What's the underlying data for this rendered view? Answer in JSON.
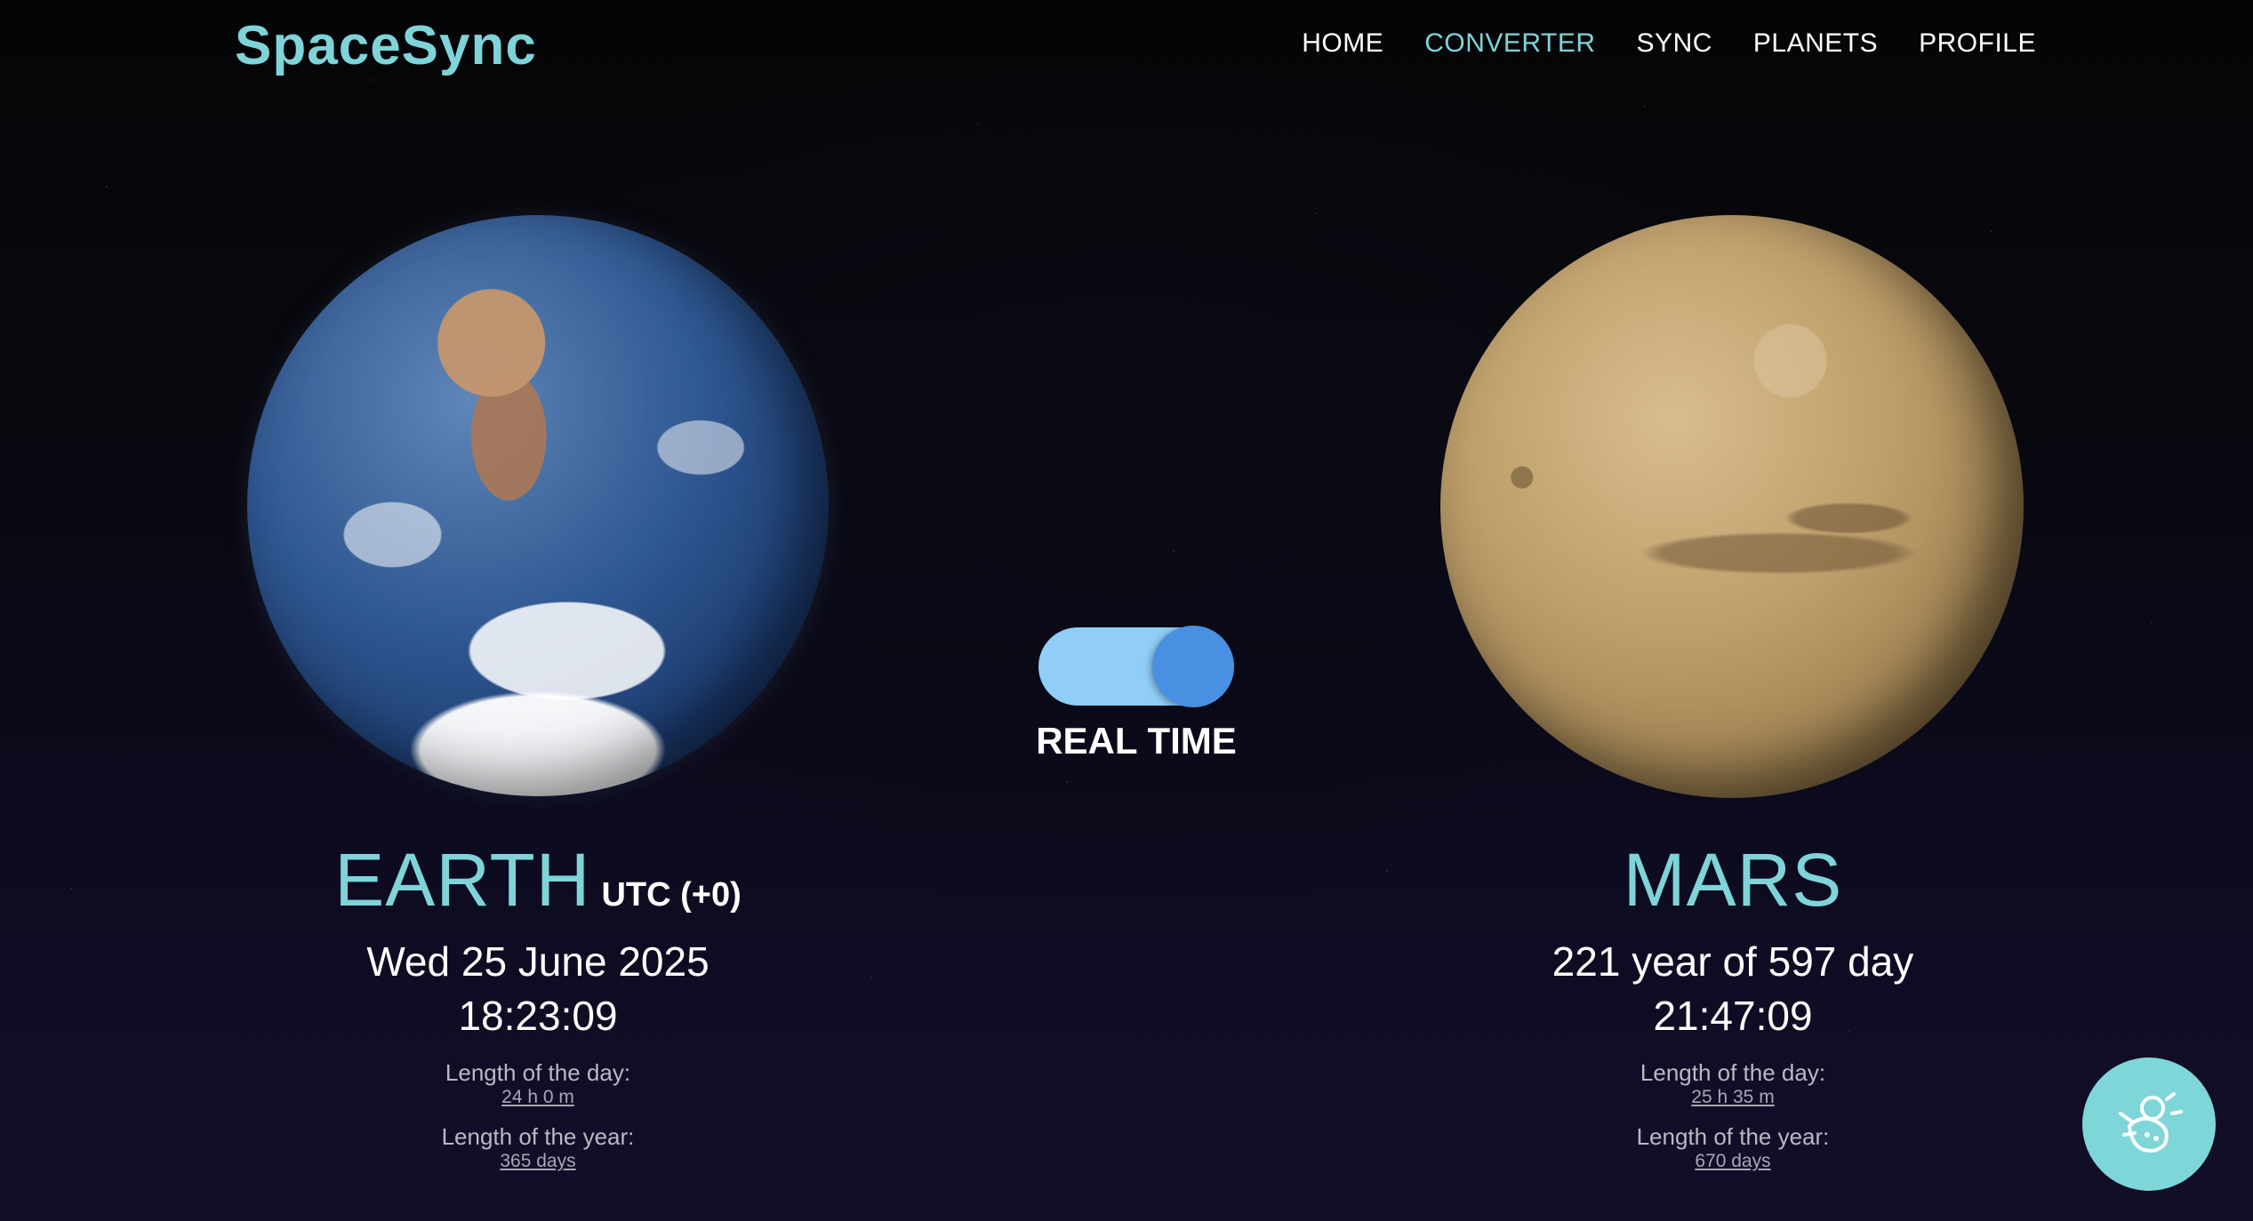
{
  "brand": {
    "name": "SpaceSync"
  },
  "nav": {
    "items": [
      {
        "label": "HOME",
        "active": false
      },
      {
        "label": "CONVERTER",
        "active": true
      },
      {
        "label": "SYNC",
        "active": false
      },
      {
        "label": "PLANETS",
        "active": false
      },
      {
        "label": "PROFILE",
        "active": false
      }
    ]
  },
  "toggle": {
    "label": "REAL TIME",
    "on": true
  },
  "earth": {
    "name": "EARTH",
    "timezone": "UTC (+0)",
    "date": "Wed 25 June 2025",
    "time": "18:23:09",
    "day_label": "Length of the day:",
    "day_value": "24 h 0 m",
    "year_label": "Length of the year:",
    "year_value": "365 days"
  },
  "mars": {
    "name": "MARS",
    "date": "221 year of 597 day",
    "time": "21:47:09",
    "day_label": "Length of the day:",
    "day_value": "25 h 35 m",
    "year_label": "Length of the year:",
    "year_value": "670 days"
  },
  "colors": {
    "accent": "#7ed4d8",
    "toggle_track": "#90cdf7",
    "toggle_knob": "#4a90e2",
    "background": "#08080f"
  },
  "icons": {
    "fab": "astronaut-icon"
  }
}
